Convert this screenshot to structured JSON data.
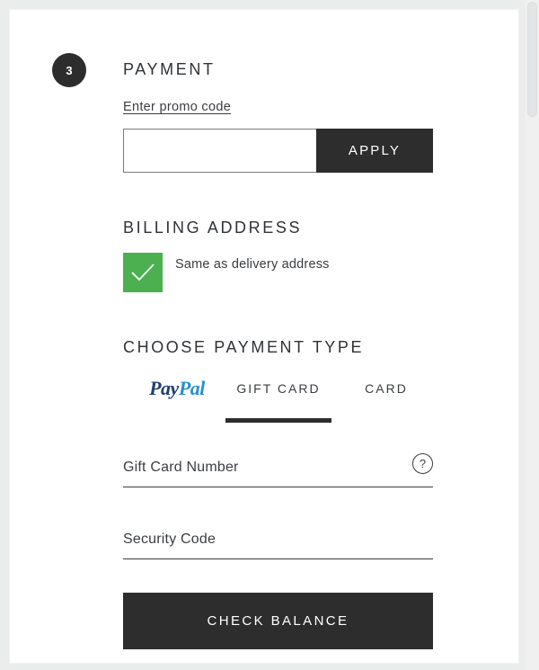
{
  "step": {
    "number": "3",
    "title": "PAYMENT"
  },
  "promo": {
    "link_label": "Enter promo code",
    "input_value": "",
    "input_placeholder": "",
    "apply_label": "APPLY"
  },
  "billing": {
    "title": "BILLING ADDRESS",
    "checkbox_label": "Same as delivery address",
    "checkbox_checked": true,
    "checkbox_color": "#4caf50",
    "check_icon": "check-icon"
  },
  "payment_type": {
    "title": "CHOOSE PAYMENT TYPE",
    "tabs": [
      {
        "id": "paypal",
        "label": "PayPal",
        "is_logo": true,
        "logo_part_1": "Pay",
        "logo_part_2": "Pal",
        "active": false
      },
      {
        "id": "giftcard",
        "label": "GIFT CARD",
        "is_logo": false,
        "active": true
      },
      {
        "id": "card",
        "label": "CARD",
        "is_logo": false,
        "active": false
      }
    ],
    "logo_color_1": "#20406f",
    "logo_color_2": "#2a8fce"
  },
  "fields": {
    "gift_card_number": {
      "placeholder": "Gift Card Number",
      "value": "",
      "help_icon": "question-mark-icon",
      "help_glyph": "?"
    },
    "security_code": {
      "placeholder": "Security Code",
      "value": ""
    }
  },
  "submit": {
    "label": "CHECK BALANCE"
  },
  "colors": {
    "dark": "#2d2d2d",
    "page_background": "#ebecec",
    "card_background": "#ffffff",
    "text": "#3a3d41"
  }
}
